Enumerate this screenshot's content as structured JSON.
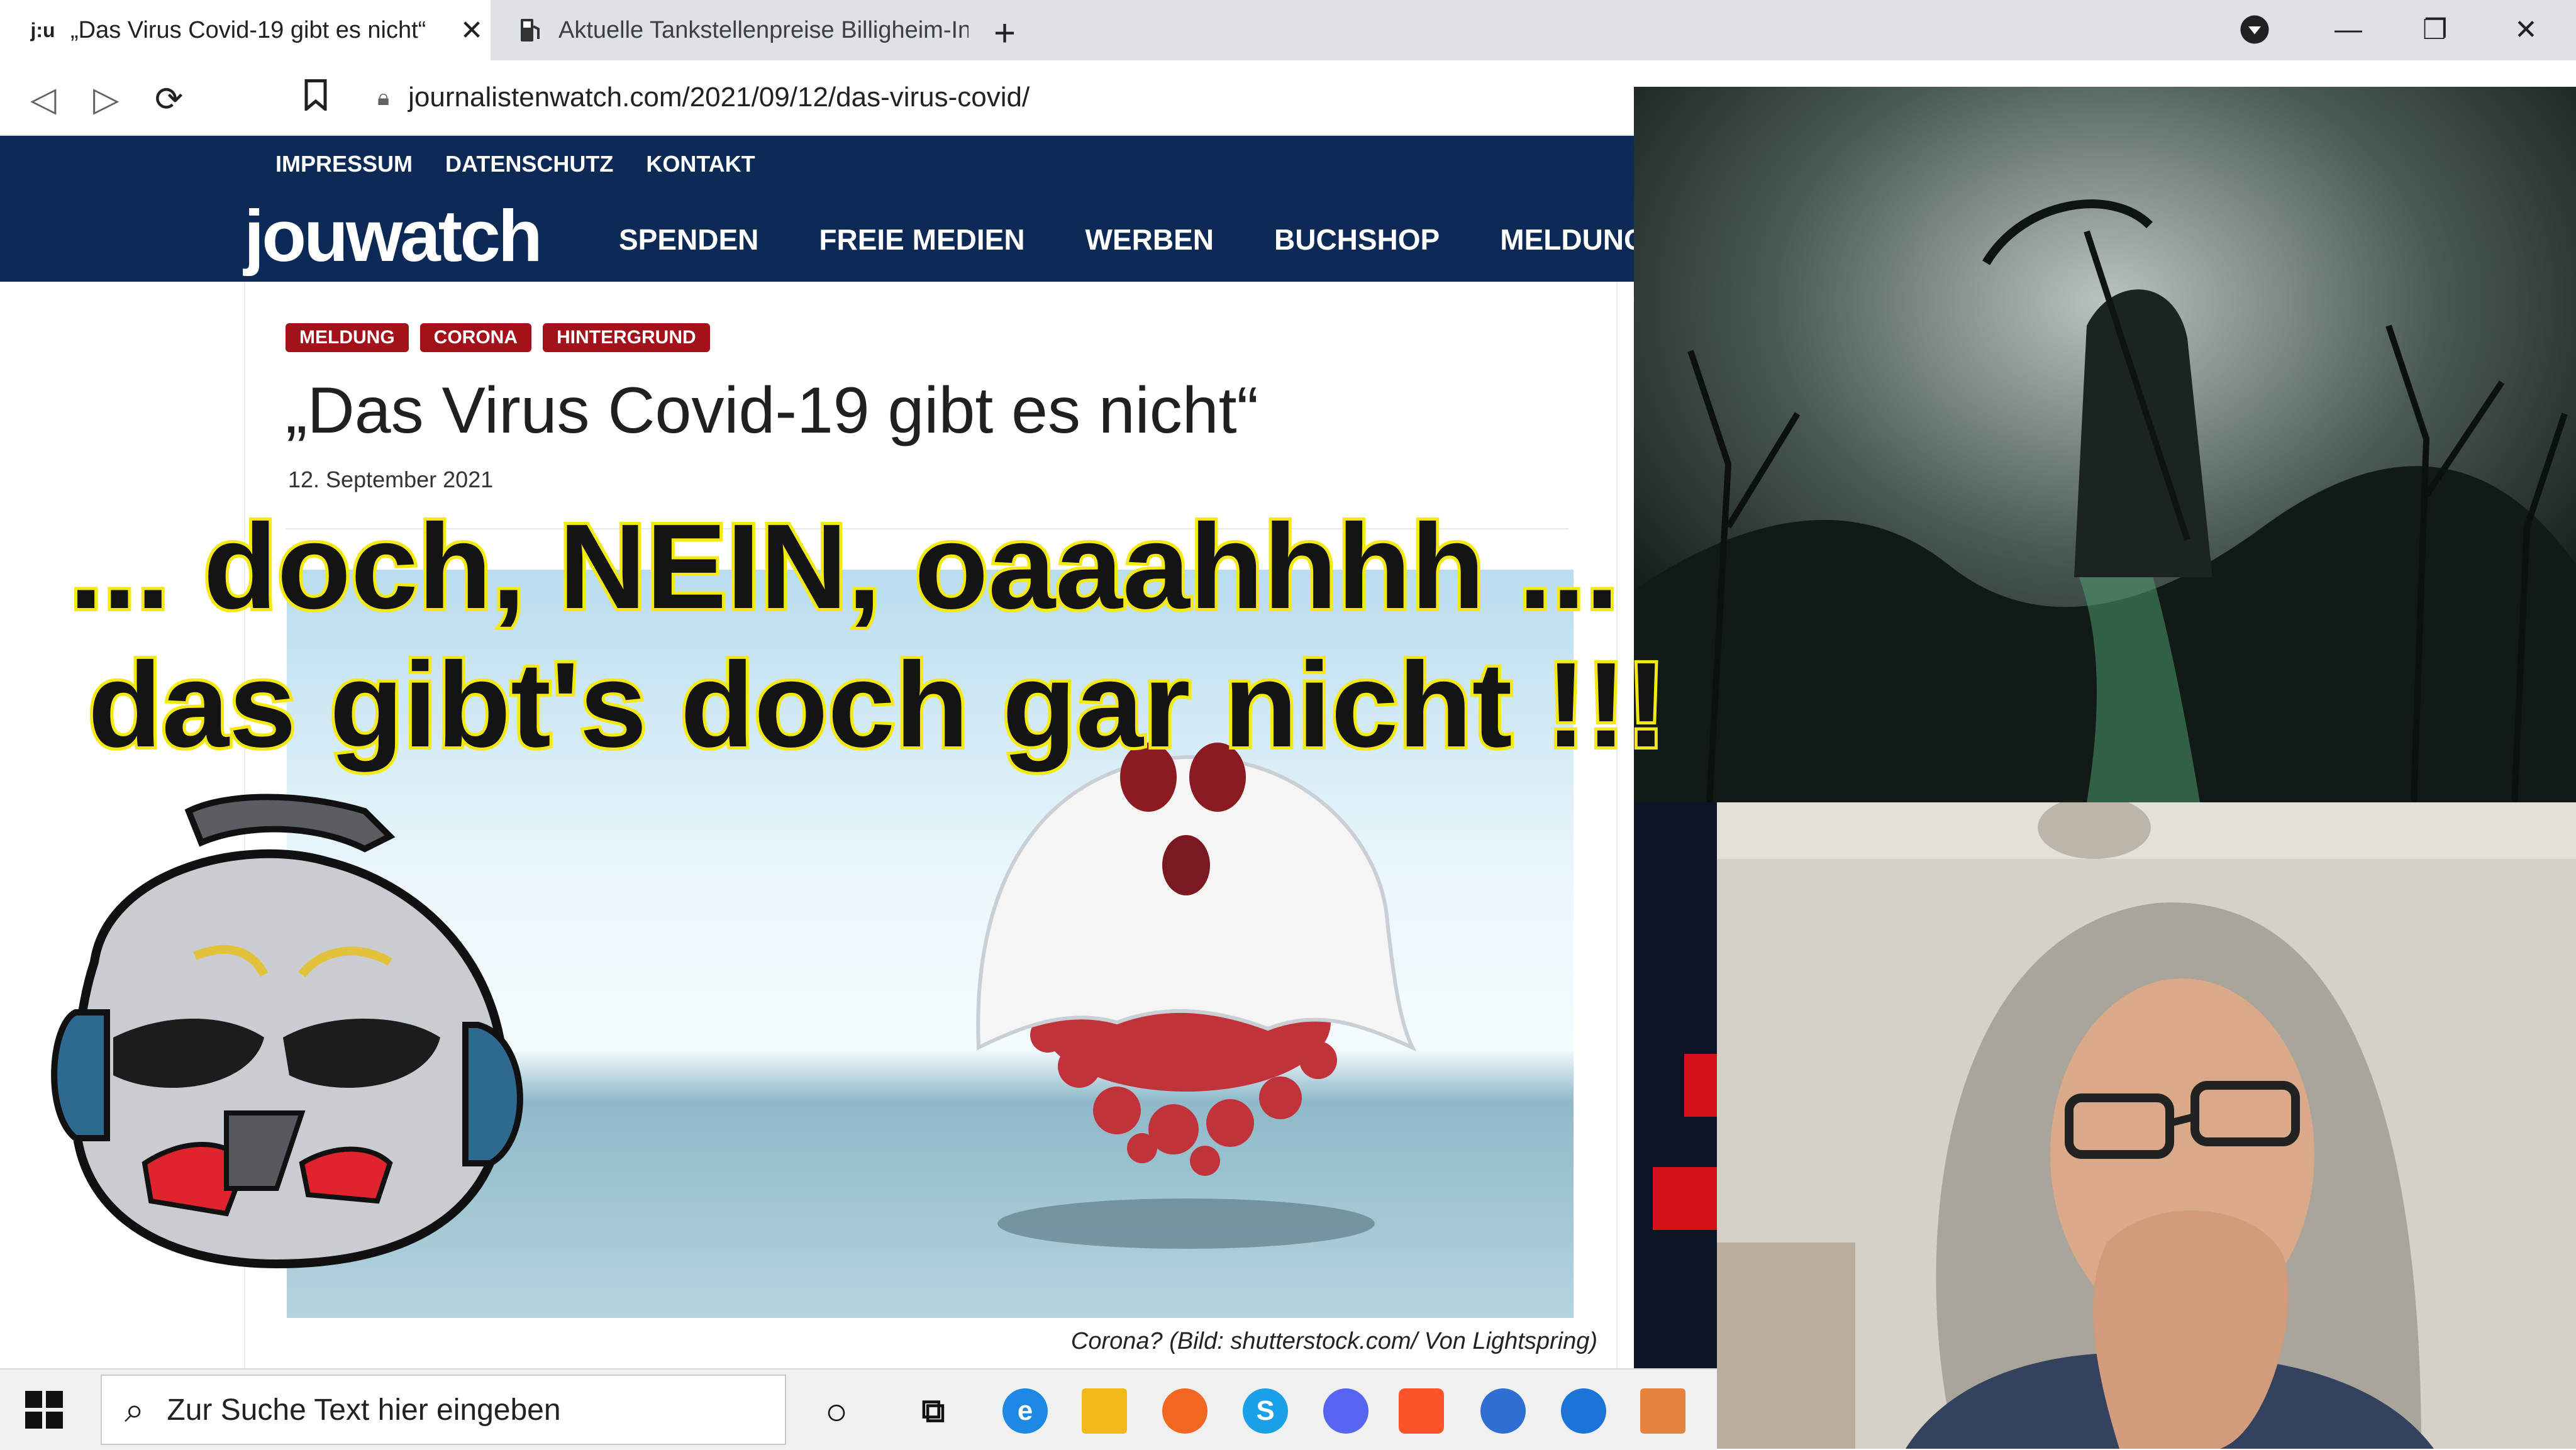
{
  "browser": {
    "tabs": [
      {
        "favicon": "j:u",
        "title": "„Das Virus Covid-19 gibt es nicht“",
        "active": true
      },
      {
        "favicon": "fuel-pump-icon",
        "title": "Aktuelle Tankstellenpreise Billigheim-Ingenheim",
        "active": false
      }
    ],
    "url": "journalistenwatch.com/2021/09/12/das-virus-covid/"
  },
  "site": {
    "top_menu": [
      "IMPRESSUM",
      "DATENSCHUTZ",
      "KONTAKT"
    ],
    "logo": "jouwatch",
    "main_menu": [
      "SPENDEN",
      "FREIE MEDIEN",
      "WERBEN",
      "BUCHSHOP",
      "MELDUNGEN"
    ],
    "colors": {
      "header": "#0c2a55",
      "tag": "#a3111a"
    }
  },
  "article": {
    "tags": [
      "MELDUNG",
      "CORONA",
      "HINTERGRUND"
    ],
    "title": "„Das Virus Covid-19 gibt es nicht“",
    "date": "12. September 2021",
    "caption": "Corona? (Bild: shutterstock.com/ Von Lightspring)"
  },
  "overlay": {
    "line1": "... doch, NEIN, oaaahhhh ...",
    "line2": "das gibt's doch gar nicht !!!",
    "colors": {
      "fill": "#141414",
      "stroke": "#f4ea12"
    }
  },
  "taskbar": {
    "search_placeholder": "Zur Suche Text hier eingeben",
    "icons": [
      "cortana-icon",
      "task-view-icon",
      "edge-icon",
      "file-explorer-icon",
      "firefox-icon",
      "skype-icon",
      "discord-icon",
      "brave-icon",
      "thunderbird-icon",
      "messenger-icon",
      "paint-icon"
    ]
  }
}
